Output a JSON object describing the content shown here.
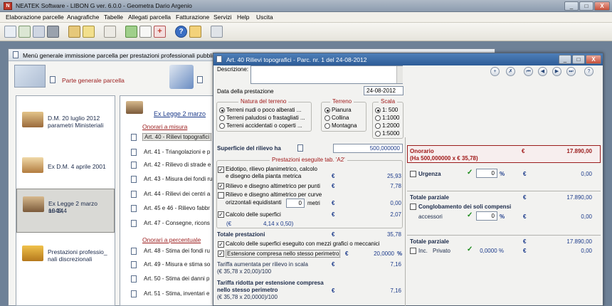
{
  "app": {
    "title": "NEATEK Software  -  LIBON G ver. 6.0.0  -  Geometra Dario Argenio",
    "min": "_",
    "max": "□",
    "close": "X"
  },
  "menu": [
    "Elaborazione parcelle",
    "Anagrafiche",
    "Tabelle",
    "Allegati parcella",
    "Fatturazione",
    "Servizi",
    "Help",
    "Uscita"
  ],
  "main_window": {
    "title": "Menù generale immissione parcella per prestazioni professionali pubbliche",
    "general_link": "Parte generale parcella"
  },
  "left_items": [
    {
      "label_1": "D.M. 20 luglio 2012",
      "label_2": "parametri Ministeriali"
    },
    {
      "label_1": "Ex D.M. 4 aprile 2001",
      "label_2": ""
    },
    {
      "label_1": "Ex Legge 2 marzo 1949,",
      "label_2": "nr. 144"
    },
    {
      "label_1": "Prestazioni professio_",
      "label_2": "nali discrezionali"
    }
  ],
  "middle": {
    "title": "Ex Legge 2 marzo",
    "section1": "Onorari a misura",
    "articles1": [
      "Art. 40 - Rilievi topografici",
      "Art. 41 - Triangolazioni e p",
      "Art. 42 - Rilievo di strade e",
      "Art. 43 - Misura dei fondi ru",
      "Art. 44 - Rilievi dei centri a",
      "Art. 45 e 46 - Rilievo fabbr",
      "Art. 47 - Consegne, ricons"
    ],
    "section2": "Onorari a percentuale",
    "articles2": [
      "Art. 48 - Stima dei fondi ru",
      "Art. 49 - Misura e stima so",
      "Art. 50 - Stima dei danni p",
      "Art. 51 - Stima, inventari e"
    ]
  },
  "dialog": {
    "title": "Art. 40 Rilievi topografici - Parc. nr. 1 del 24-08-2012",
    "descrizione_label": "Descrizione:",
    "data_label": "Data della prestazione",
    "data_value": "24-08-2012",
    "natura_title": "Natura del terreno",
    "natura": [
      "Terreni nudi o poco alberati ...",
      "Terreni paludosi o frastagliati ...",
      "Terreni accidentati o coperti ..."
    ],
    "terreno_title": "Terreno",
    "terreno": [
      "Pianura",
      "Collina",
      "Montagna"
    ],
    "scala_title": "Scala",
    "scala": [
      "1: 500",
      "1:1000",
      "1:2000",
      "1:5000"
    ],
    "superficie_label": "Superficie del rilievo ha",
    "superficie_value": "500,000000",
    "prest_title": "Prestazioni eseguite tab. 'A2'",
    "prest": [
      {
        "l1": "Eidotipo, rilievo planimetrico, calcolo",
        "l2": "e disegno della pianta metrica",
        "v": "25,93"
      },
      {
        "l1": "Rilievo e disegno altimetrico per punti",
        "l2": "",
        "v": "7,78"
      },
      {
        "l1": "Rilievo e disegno altimetrico per curve",
        "l2": "orizzontali equidistanti",
        "metri_value": "0",
        "metri": "metri",
        "v": "0,00"
      },
      {
        "l1": "Calcolo delle superfici",
        "l2": "",
        "v": "2,07"
      }
    ],
    "calc_prefix": "(€",
    "calc_value": "4,14 x 0,50)",
    "totale_prest_label": "Totale prestazioni",
    "totale_prest_value": "35,78",
    "mezzi_label": "Calcolo delle superfici eseguito con mezzi grafici o meccanici",
    "estensione_label": "Estensione compresa nello stesso perimetro",
    "estensione_value": "20,0000",
    "estensione_unit": "%",
    "tariffa1_l1": "Tariffa aumentata per rilievo in scala",
    "tariffa1_l2": "(€ 35,78 x 20,00)/100",
    "tariffa1_v": "7,16",
    "tariffa2_l1": "Tariffa ridotta per estensione compresa",
    "tariffa2_l2": "nello stesso perimetro",
    "tariffa2_l3": "(€ 35,78 x 20,0000)/100",
    "tariffa2_v": "7,16",
    "euro": "€",
    "nav_buttons": [
      "+",
      "✗",
      "⏮",
      "◀",
      "▶",
      "⏭",
      "?"
    ]
  },
  "right": {
    "onorario_label": "Onorario",
    "onorario_calc": "(Ha 500,000000 x € 35,78)",
    "onorario_value": "17.890,00",
    "urgenza_label": "Urgenza",
    "urgenza_pct": "0",
    "urgenza_value": "0,00",
    "tot_parz1_label": "Totale parziale",
    "tot_parz1_value": "17.890,00",
    "conglob_label": "Conglobamento dei soli compensi",
    "accessori_label": "accessori",
    "accessori_pct": "0",
    "accessori_value": "0,00",
    "tot_parz2_label": "Totale parziale",
    "tot_parz2_value": "17.890,00",
    "inc_label": "Inc.",
    "privato_label": "Privato",
    "inc_pct": "0,0000 %",
    "inc_value": "0,00",
    "pct_sign": "%"
  }
}
